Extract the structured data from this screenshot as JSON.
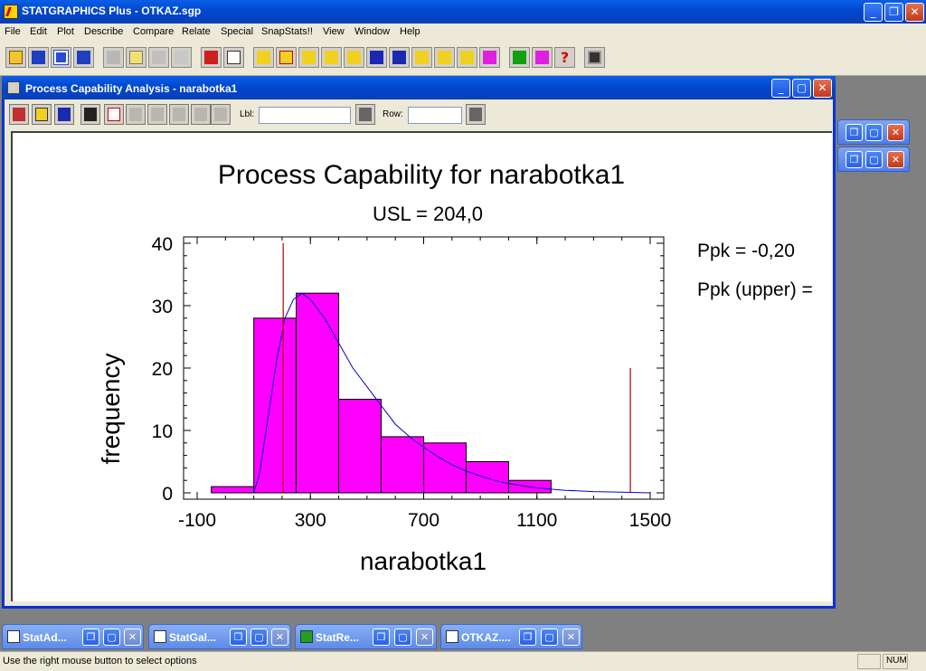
{
  "app": {
    "title": "STATGRAPHICS Plus - OTKAZ.sgp",
    "caption_buttons": {
      "minimize": "_",
      "restore": "❐",
      "close": "✕"
    }
  },
  "menu": [
    "File",
    "Edit",
    "Plot",
    "Describe",
    "Compare",
    "Relate",
    "Special",
    "SnapStats!!",
    "View",
    "Window",
    "Help"
  ],
  "child_window": {
    "title": "Process Capability Analysis - narabotka1",
    "lbl_label": "Lbl:",
    "lbl_value": "",
    "row_label": "Row:",
    "row_value": ""
  },
  "chart_data": {
    "type": "bar",
    "title": "Process Capability for narabotka1",
    "subtitle": "USL = 204,0",
    "xlabel": "narabotka1",
    "ylabel": "frequency",
    "xlim": [
      -100,
      1500
    ],
    "ylim": [
      0,
      40
    ],
    "x_ticks": [
      "-100",
      "300",
      "700",
      "1100",
      "1500"
    ],
    "y_ticks": [
      "0",
      "10",
      "20",
      "30",
      "40"
    ],
    "bins": [
      {
        "from": -50,
        "to": 100,
        "count": 1
      },
      {
        "from": 100,
        "to": 250,
        "count": 28
      },
      {
        "from": 250,
        "to": 400,
        "count": 32
      },
      {
        "from": 400,
        "to": 550,
        "count": 15
      },
      {
        "from": 550,
        "to": 700,
        "count": 9
      },
      {
        "from": 700,
        "to": 850,
        "count": 8
      },
      {
        "from": 850,
        "to": 1000,
        "count": 5
      },
      {
        "from": 1000,
        "to": 1150,
        "count": 2
      }
    ],
    "fit_curve": [
      [
        100,
        0
      ],
      [
        120,
        3
      ],
      [
        150,
        12
      ],
      [
        180,
        21
      ],
      [
        210,
        28
      ],
      [
        240,
        31
      ],
      [
        270,
        32
      ],
      [
        300,
        31
      ],
      [
        350,
        28
      ],
      [
        400,
        24
      ],
      [
        450,
        20
      ],
      [
        500,
        17
      ],
      [
        550,
        14
      ],
      [
        600,
        11
      ],
      [
        650,
        9
      ],
      [
        700,
        7.3
      ],
      [
        750,
        5.8
      ],
      [
        800,
        4.5
      ],
      [
        850,
        3.5
      ],
      [
        900,
        2.7
      ],
      [
        950,
        2
      ],
      [
        1000,
        1.5
      ],
      [
        1050,
        1.1
      ],
      [
        1100,
        0.8
      ],
      [
        1200,
        0.4
      ],
      [
        1300,
        0.2
      ],
      [
        1400,
        0.1
      ],
      [
        1500,
        0
      ]
    ],
    "spec_lines": [
      {
        "x": 204,
        "height": 40
      },
      {
        "x": 1430,
        "height": 20
      }
    ],
    "bar_color": "#ff00ff",
    "curve_color": "#0000cc",
    "spec_color": "#aa0000",
    "annotations": [
      "Ppk = -0,20",
      "Ppk (upper) ="
    ]
  },
  "minimized_windows": [
    {
      "label": "StatAd..."
    },
    {
      "label": "StatGal..."
    },
    {
      "label": "StatRe..."
    },
    {
      "label": "OTKAZ...."
    }
  ],
  "status": {
    "message": "Use the right mouse button to select options",
    "num": "NUM"
  }
}
